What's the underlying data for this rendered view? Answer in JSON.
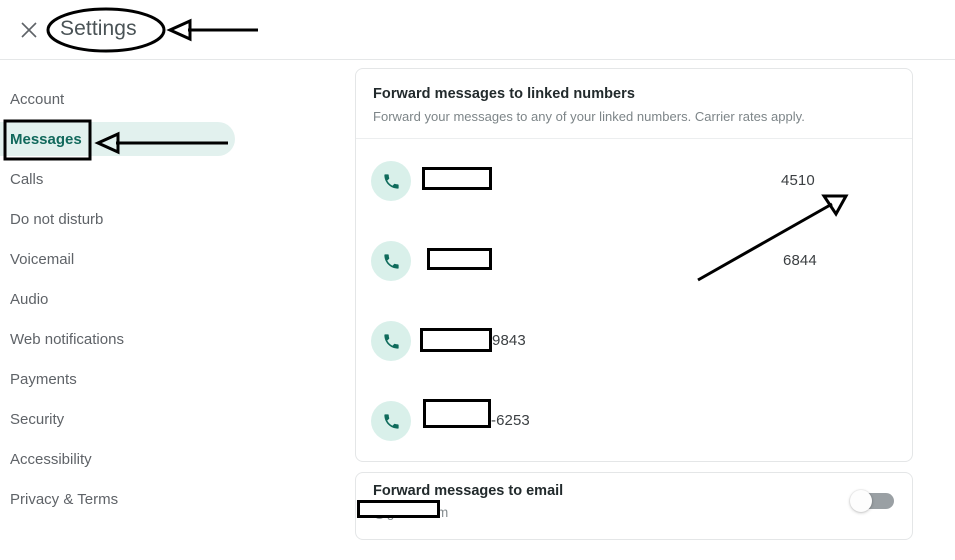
{
  "header": {
    "title": "Settings",
    "close_icon": "close-x-icon"
  },
  "sidebar": {
    "items": [
      {
        "label": "Account",
        "active": false
      },
      {
        "label": "Messages",
        "active": true
      },
      {
        "label": "Calls",
        "active": false
      },
      {
        "label": "Do not disturb",
        "active": false
      },
      {
        "label": "Voicemail",
        "active": false
      },
      {
        "label": "Audio",
        "active": false
      },
      {
        "label": "Web notifications",
        "active": false
      },
      {
        "label": "Payments",
        "active": false
      },
      {
        "label": "Security",
        "active": false
      },
      {
        "label": "Accessibility",
        "active": false
      },
      {
        "label": "Privacy & Terms",
        "active": false
      }
    ]
  },
  "linked_numbers_card": {
    "title": "Forward messages to linked numbers",
    "subtitle": "Forward your messages to any of your linked numbers. Carrier rates apply.",
    "rows": [
      {
        "number_suffix": "4510",
        "icon": "phone-icon",
        "toggle_state": "off"
      },
      {
        "number_suffix": "6844",
        "icon": "phone-icon",
        "toggle_state": "hover"
      },
      {
        "number_suffix": "9843",
        "icon": "phone-icon",
        "toggle_state": "off"
      },
      {
        "number_suffix": "-6253",
        "icon": "phone-icon",
        "toggle_state": "off"
      }
    ]
  },
  "email_card": {
    "title": "Forward messages to email",
    "address_suffix": "@gmail.com",
    "toggle_state": "hover"
  },
  "colors": {
    "accent_teal": "#11695c",
    "accent_bg": "#e2f1ee",
    "badge_bg": "#d9f0ea",
    "text_primary": "#222a2c",
    "text_secondary": "#7d8588",
    "border": "#e4e6e7",
    "toggle_off_track": "#e8eaed",
    "toggle_off_knob": "#bdbdbd",
    "annotation": "#000000"
  },
  "annotations": {
    "title_ellipse": "ellipse-around-settings-title",
    "title_arrow": "arrow-pointing-to-settings-title",
    "messages_box": "box-around-messages-nav-item",
    "messages_arrow": "arrow-pointing-to-messages-nav-item",
    "toggle_arrow": "arrow-pointing-to-first-toggle",
    "redaction_boxes": 5
  }
}
